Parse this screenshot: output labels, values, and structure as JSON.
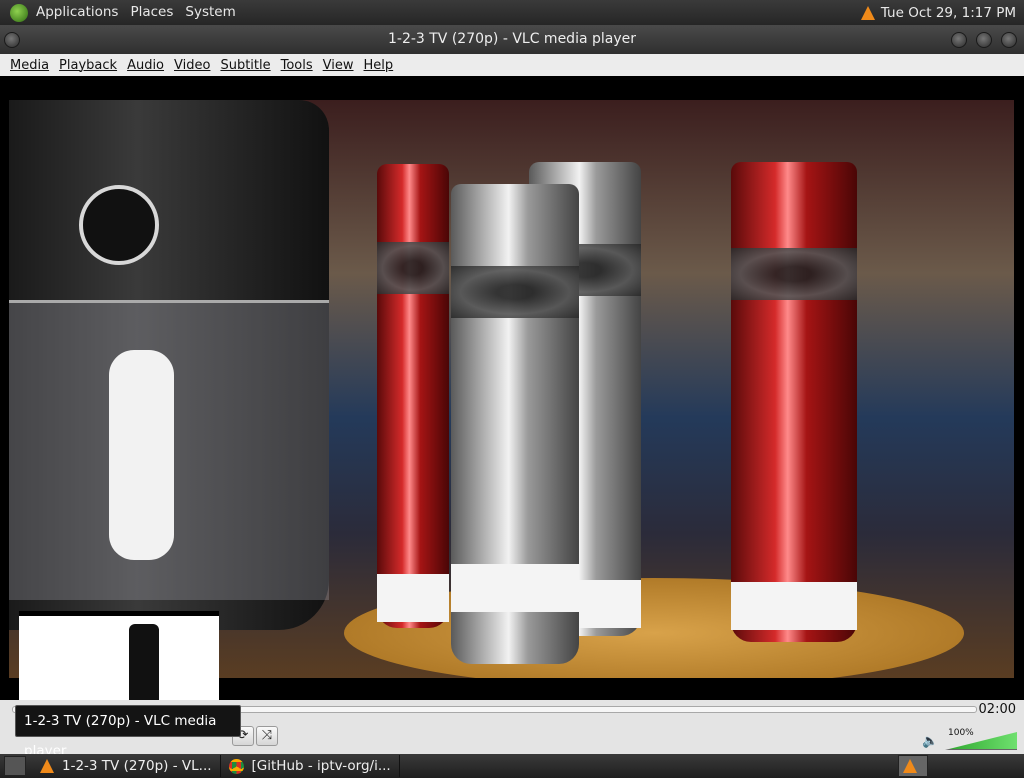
{
  "panel": {
    "menus": [
      "Applications",
      "Places",
      "System"
    ],
    "datetime": "Tue Oct 29,  1:17 PM"
  },
  "window": {
    "title": "1-2-3 TV (270p) - VLC media player"
  },
  "menubar": {
    "items": [
      "Media",
      "Playback",
      "Audio",
      "Video",
      "Subtitle",
      "Tools",
      "View",
      "Help"
    ]
  },
  "controls": {
    "elapsed": "",
    "total": "02:00",
    "volume_label": "100%",
    "volume": 1.0
  },
  "tooltip": "1-2-3 TV (270p) - VLC media player",
  "taskbar": {
    "tasks": [
      {
        "label": "1-2-3 TV (270p) - VL...",
        "icon": "vlc-cone-icon"
      },
      {
        "label": "[GitHub - iptv-org/i...",
        "icon": "chrome-icon"
      }
    ]
  },
  "colors": {
    "vlc_orange": "#f08a1a",
    "panel_bg": "#2e2e2e"
  }
}
